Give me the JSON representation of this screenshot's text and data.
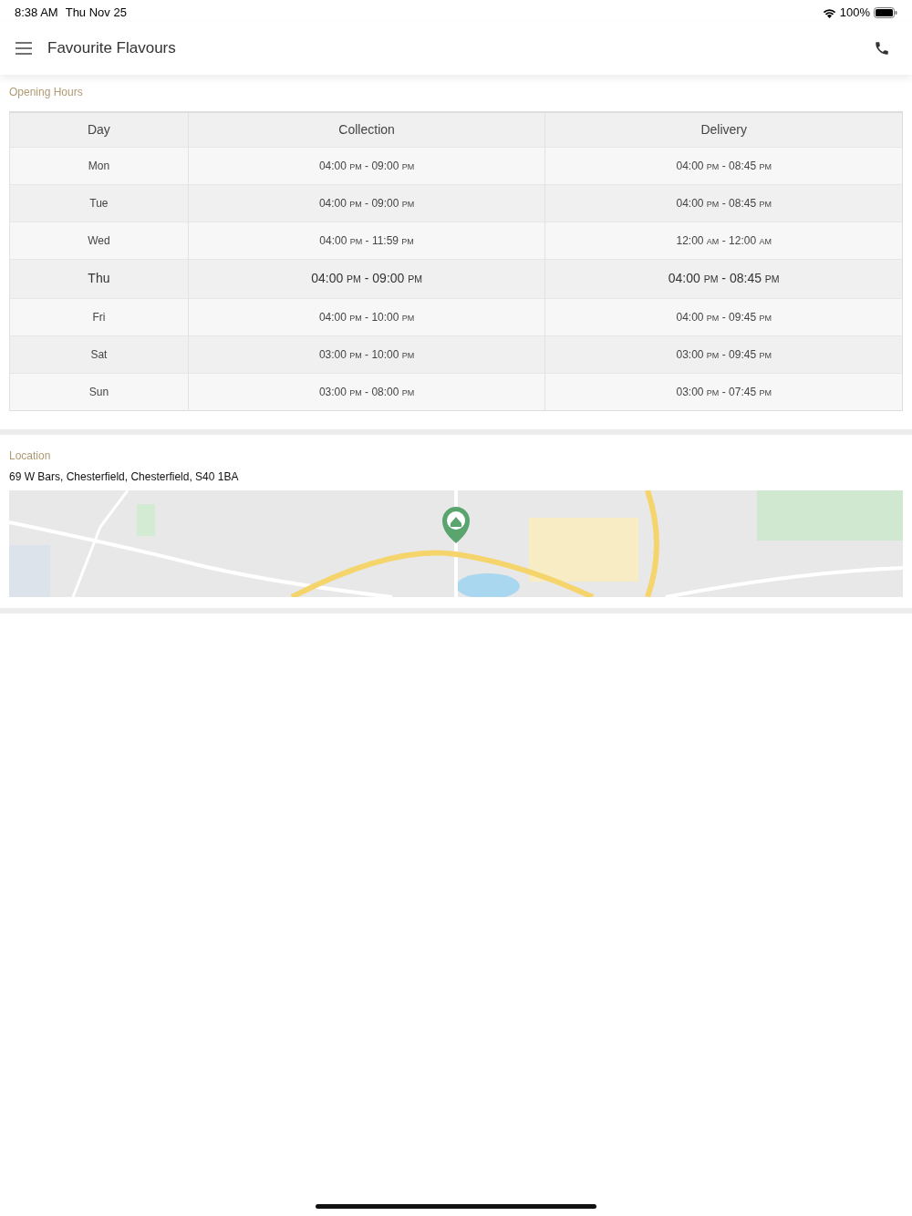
{
  "status_bar": {
    "time": "8:38 AM",
    "date": "Thu Nov 25",
    "battery": "100%"
  },
  "app_bar": {
    "title": "Favourite Flavours"
  },
  "opening_hours": {
    "heading": "Opening Hours",
    "range_separator": "-",
    "columns": [
      "Day",
      "Collection",
      "Delivery"
    ],
    "rows": [
      {
        "day": "Mon",
        "current": false,
        "collection": [
          {
            "time": "04:00",
            "period": "PM"
          },
          {
            "time": "09:00",
            "period": "PM"
          }
        ],
        "delivery": [
          {
            "time": "04:00",
            "period": "PM"
          },
          {
            "time": "08:45",
            "period": "PM"
          }
        ]
      },
      {
        "day": "Tue",
        "current": false,
        "collection": [
          {
            "time": "04:00",
            "period": "PM"
          },
          {
            "time": "09:00",
            "period": "PM"
          }
        ],
        "delivery": [
          {
            "time": "04:00",
            "period": "PM"
          },
          {
            "time": "08:45",
            "period": "PM"
          }
        ]
      },
      {
        "day": "Wed",
        "current": false,
        "collection": [
          {
            "time": "04:00",
            "period": "PM"
          },
          {
            "time": "11:59",
            "period": "PM"
          }
        ],
        "delivery": [
          {
            "time": "12:00",
            "period": "AM"
          },
          {
            "time": "12:00",
            "period": "AM"
          }
        ]
      },
      {
        "day": "Thu",
        "current": true,
        "collection": [
          {
            "time": "04:00",
            "period": "PM"
          },
          {
            "time": "09:00",
            "period": "PM"
          }
        ],
        "delivery": [
          {
            "time": "04:00",
            "period": "PM"
          },
          {
            "time": "08:45",
            "period": "PM"
          }
        ]
      },
      {
        "day": "Fri",
        "current": false,
        "collection": [
          {
            "time": "04:00",
            "period": "PM"
          },
          {
            "time": "10:00",
            "period": "PM"
          }
        ],
        "delivery": [
          {
            "time": "04:00",
            "period": "PM"
          },
          {
            "time": "09:45",
            "period": "PM"
          }
        ]
      },
      {
        "day": "Sat",
        "current": false,
        "collection": [
          {
            "time": "03:00",
            "period": "PM"
          },
          {
            "time": "10:00",
            "period": "PM"
          }
        ],
        "delivery": [
          {
            "time": "03:00",
            "period": "PM"
          },
          {
            "time": "09:45",
            "period": "PM"
          }
        ]
      },
      {
        "day": "Sun",
        "current": false,
        "collection": [
          {
            "time": "03:00",
            "period": "PM"
          },
          {
            "time": "08:00",
            "period": "PM"
          }
        ],
        "delivery": [
          {
            "time": "03:00",
            "period": "PM"
          },
          {
            "time": "07:45",
            "period": "PM"
          }
        ]
      }
    ]
  },
  "location": {
    "heading": "Location",
    "address": "69 W Bars, Chesterfield, Chesterfield, S40 1BA"
  }
}
